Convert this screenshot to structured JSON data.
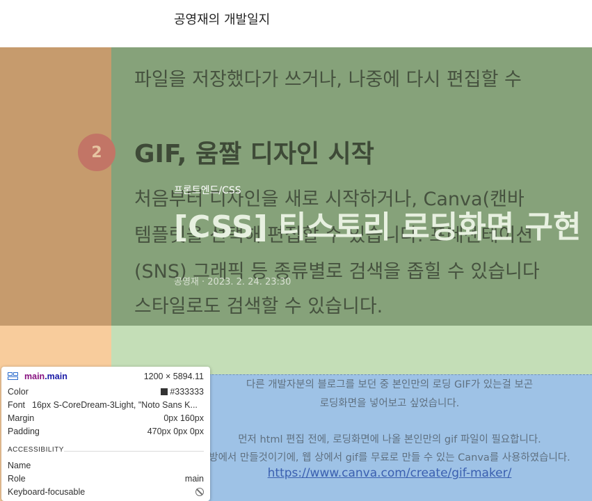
{
  "header": {
    "blog_title": "공영재의 개발일지"
  },
  "hero_background": {
    "lines": [
      "파일을 저장했다가 쓰거나, 나중에 다시 편집할 수",
      "처음부터 디자인을 새로 시작하거나, Canva(캔바",
      "템플릿을 선택해 편집할 수 있습니다. 프레젠테이션",
      "(SNS) 그래픽 등 종류별로 검색을 좁힐 수 있습니다",
      "스타일로도 검색할 수 있습니다."
    ],
    "heading": "GIF, 움짤 디자인 시작",
    "step_number": "2"
  },
  "post": {
    "category": "프론트엔드/CSS",
    "title": "[CSS] 티스토리 로딩화면 구현",
    "meta": "공영재 · 2023. 2. 24. 23:30"
  },
  "content": {
    "paragraph1_line1": "다른 개발자분의 블로그를 보던 중 본인만의 로딩 GIF가 있는걸 보곤",
    "paragraph1_line2": "로딩화면을 넣어보고 싶었습니다.",
    "paragraph2_line1": "먼저 html 편집 전에, 로딩화면에 나올 본인만의 gif 파일이 필요합니다.",
    "paragraph2_line2": "방에서 만들것이기에, 웹 상에서 gif를 무료로 만들 수 있는 Canva를 사용하였습니다.",
    "link": "https://www.canva.com/create/gif-maker/"
  },
  "inspector": {
    "selector_tag": "main",
    "selector_class": ".main",
    "size": "1200 × 5894.11",
    "rows": [
      {
        "key": "Color",
        "value": "#333333"
      },
      {
        "key": "Font",
        "value": "16px S-CoreDream-3Light, \"Noto Sans K..."
      },
      {
        "key": "Margin",
        "value": "0px 160px"
      },
      {
        "key": "Padding",
        "value": "470px 0px 0px"
      }
    ],
    "accessibility_title": "ACCESSIBILITY",
    "a11y_rows": [
      {
        "key": "Name",
        "value": ""
      },
      {
        "key": "Role",
        "value": "main"
      },
      {
        "key": "Keyboard-focusable",
        "value": ""
      }
    ]
  },
  "colors": {
    "margin_overlay": "#f8cc9c",
    "padding_overlay": "#c4deb7",
    "content_overlay": "#9ec2e6",
    "text_color": "#333333"
  }
}
